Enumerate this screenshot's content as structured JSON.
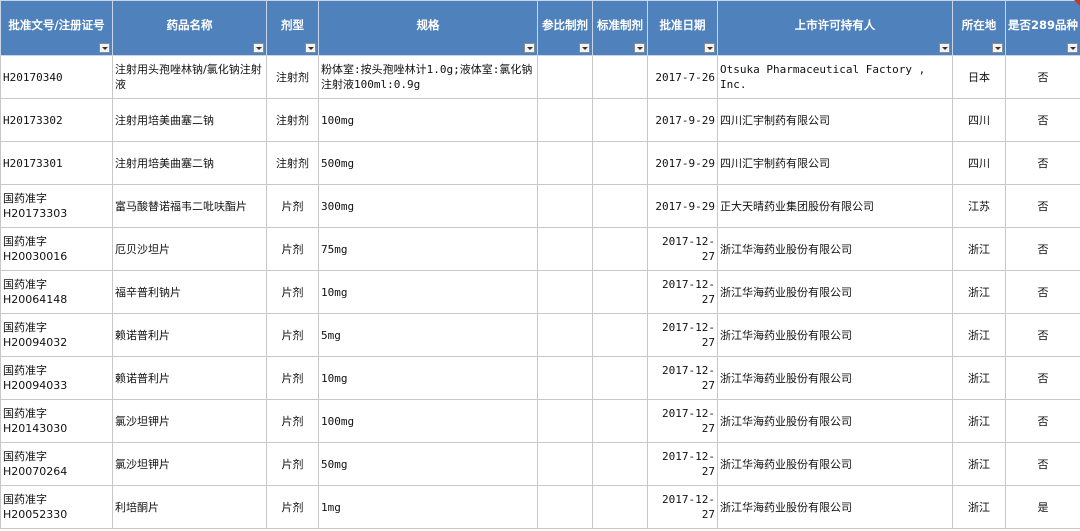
{
  "sheet": {
    "headers": [
      {
        "label": "批准文号/注册证号"
      },
      {
        "label": "药品名称"
      },
      {
        "label": "剂型"
      },
      {
        "label": "规格"
      },
      {
        "label": "参比制剂"
      },
      {
        "label": "标准制剂"
      },
      {
        "label": "批准日期"
      },
      {
        "label": "上市许可持有人"
      },
      {
        "label": "所在地"
      },
      {
        "label": "是否289品种"
      }
    ],
    "rows": [
      {
        "approval": "H20170340",
        "name": "注射用头孢唑林钠/氯化钠注射液",
        "form": "注射剂",
        "spec": "粉体室:按头孢唑林计1.0g;液体室:氯化钠注射液100ml:0.9g",
        "ref": "",
        "std": "",
        "date": "2017-7-26",
        "holder": "Otsuka Pharmaceutical Factory , Inc.",
        "location": "日本",
        "is289": "否"
      },
      {
        "approval": "H20173302",
        "name": "注射用培美曲塞二钠",
        "form": "注射剂",
        "spec": "100mg",
        "ref": "",
        "std": "",
        "date": "2017-9-29",
        "holder": "四川汇宇制药有限公司",
        "location": "四川",
        "is289": "否"
      },
      {
        "approval": "H20173301",
        "name": "注射用培美曲塞二钠",
        "form": "注射剂",
        "spec": "500mg",
        "ref": "",
        "std": "",
        "date": "2017-9-29",
        "holder": "四川汇宇制药有限公司",
        "location": "四川",
        "is289": "否"
      },
      {
        "approval": "国药准字H20173303",
        "name": "富马酸替诺福韦二吡呋酯片",
        "form": "片剂",
        "spec": "300mg",
        "ref": "",
        "std": "",
        "date": "2017-9-29",
        "holder": "正大天晴药业集团股份有限公司",
        "location": "江苏",
        "is289": "否"
      },
      {
        "approval": "国药准字H20030016",
        "name": "厄贝沙坦片",
        "form": "片剂",
        "spec": "75mg",
        "ref": "",
        "std": "",
        "date": "2017-12-27",
        "holder": "浙江华海药业股份有限公司",
        "location": "浙江",
        "is289": "否"
      },
      {
        "approval": "国药准字H20064148",
        "name": "福辛普利钠片",
        "form": "片剂",
        "spec": "10mg",
        "ref": "",
        "std": "",
        "date": "2017-12-27",
        "holder": "浙江华海药业股份有限公司",
        "location": "浙江",
        "is289": "否"
      },
      {
        "approval": "国药准字H20094032",
        "name": "赖诺普利片",
        "form": "片剂",
        "spec": "5mg",
        "ref": "",
        "std": "",
        "date": "2017-12-27",
        "holder": "浙江华海药业股份有限公司",
        "location": "浙江",
        "is289": "否"
      },
      {
        "approval": "国药准字H20094033",
        "name": "赖诺普利片",
        "form": "片剂",
        "spec": "10mg",
        "ref": "",
        "std": "",
        "date": "2017-12-27",
        "holder": "浙江华海药业股份有限公司",
        "location": "浙江",
        "is289": "否"
      },
      {
        "approval": "国药准字H20143030",
        "name": "氯沙坦钾片",
        "form": "片剂",
        "spec": "100mg",
        "ref": "",
        "std": "",
        "date": "2017-12-27",
        "holder": "浙江华海药业股份有限公司",
        "location": "浙江",
        "is289": "否"
      },
      {
        "approval": "国药准字H20070264",
        "name": "氯沙坦钾片",
        "form": "片剂",
        "spec": "50mg",
        "ref": "",
        "std": "",
        "date": "2017-12-27",
        "holder": "浙江华海药业股份有限公司",
        "location": "浙江",
        "is289": "否"
      },
      {
        "approval": "国药准字H20052330",
        "name": "利培酮片",
        "form": "片剂",
        "spec": "1mg",
        "ref": "",
        "std": "",
        "date": "2017-12-27",
        "holder": "浙江华海药业股份有限公司",
        "location": "浙江",
        "is289": "是"
      }
    ],
    "colors": {
      "header_bg": "#4f81bd",
      "header_text": "#ffffff",
      "grid": "#c8c8c8",
      "comment_marker": "#c0392b"
    },
    "icons": {
      "filter": "dropdown-filter-icon",
      "comment": "comment-indicator-icon"
    }
  }
}
